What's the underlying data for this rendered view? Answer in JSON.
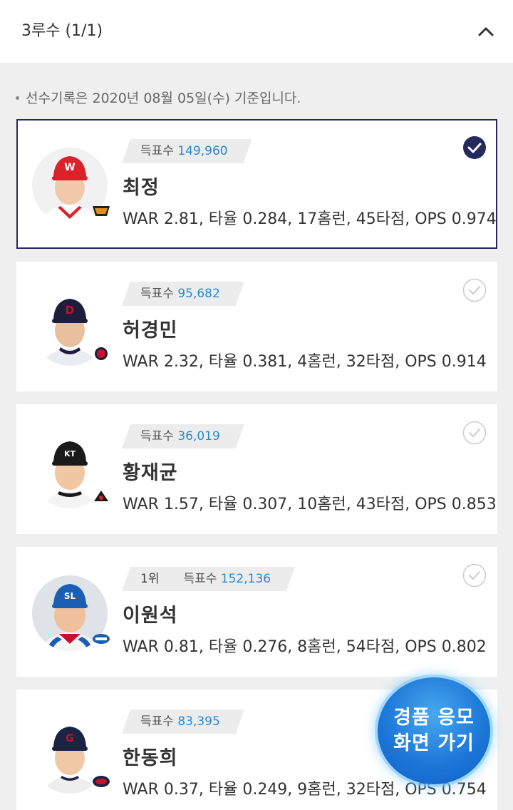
{
  "header": {
    "title": "3루수 (1/1)"
  },
  "notice": "선수기록은 2020년 08월 05일(수) 기준입니다.",
  "players": [
    {
      "rank": "",
      "vote_label": "득표수",
      "votes": "149,960",
      "name": "최정",
      "stats": "WAR 2.81, 타율 0.284, 17홈런, 45타점, OPS 0.974",
      "selected": true,
      "team_logo": "tigers-logo",
      "cap_color": "#d9222a"
    },
    {
      "rank": "",
      "vote_label": "득표수",
      "votes": "95,682",
      "name": "허경민",
      "stats": "WAR 2.32, 타율 0.381, 4홈런, 32타점, OPS 0.914",
      "selected": false,
      "team_logo": "bears-logo",
      "cap_color": "#1c1f3a"
    },
    {
      "rank": "",
      "vote_label": "득표수",
      "votes": "36,019",
      "name": "황재균",
      "stats": "WAR 1.57, 타율 0.307, 10홈런, 43타점, OPS 0.853",
      "selected": false,
      "team_logo": "kt-wiz-logo",
      "cap_color": "#1a1a1a"
    },
    {
      "rank": "1위",
      "vote_label": "득표수",
      "votes": "152,136",
      "name": "이원석",
      "stats": "WAR 0.81, 타율 0.276, 8홈런, 54타점, OPS 0.802",
      "selected": false,
      "team_logo": "lions-logo",
      "cap_color": "#1b5fb5"
    },
    {
      "rank": "",
      "vote_label": "득표수",
      "votes": "83,395",
      "name": "한동희",
      "stats": "WAR 0.37, 타율 0.249, 9홈런, 32타점, OPS 0.754",
      "selected": false,
      "team_logo": "giants-logo",
      "cap_color": "#1c2444"
    }
  ],
  "cta": {
    "label": "경품 응모 화면 가기"
  },
  "colors": {
    "accent": "#242a5c",
    "vote_count": "#2a8ad0",
    "cta": "#1d78d8"
  }
}
